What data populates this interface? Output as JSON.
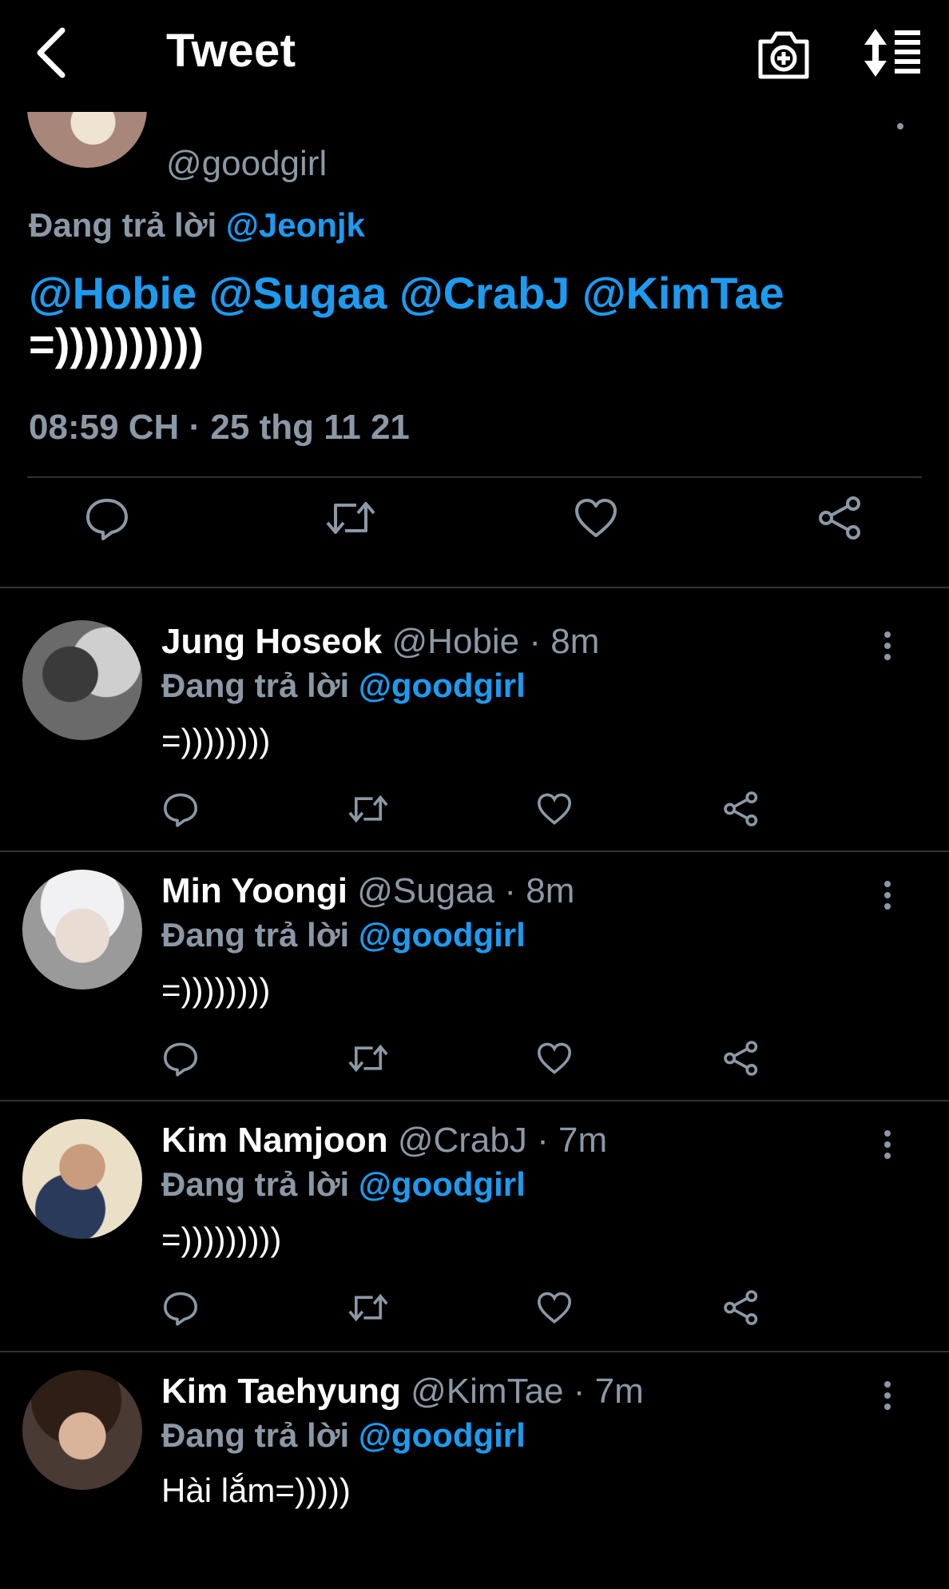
{
  "header": {
    "title": "Tweet",
    "back_icon": "chevron-left-icon",
    "camera_icon": "camera-add-icon",
    "sort_icon": "sort-list-icon"
  },
  "main_tweet": {
    "handle": "@goodgirl",
    "replying_prefix": "Đang trả lời",
    "replying_to": "@Jeonjk",
    "mentions": [
      "@Hobie",
      "@Sugaa",
      "@CrabJ",
      "@KimTae"
    ],
    "text": "=))))))))))",
    "timestamp": "08:59 CH · 25 thg 11 21"
  },
  "replies": [
    {
      "name": "Jung Hoseok",
      "handle": "@Hobie",
      "time": "8m",
      "replying_prefix": "Đang trả lời",
      "replying_to": "@goodgirl",
      "text": "=))))))))"
    },
    {
      "name": "Min Yoongi",
      "handle": "@Sugaa",
      "time": "8m",
      "replying_prefix": "Đang trả lời",
      "replying_to": "@goodgirl",
      "text": "=))))))))"
    },
    {
      "name": "Kim Namjoon",
      "handle": "@CrabJ",
      "time": "7m",
      "replying_prefix": "Đang trả lời",
      "replying_to": "@goodgirl",
      "text": "=)))))))))"
    },
    {
      "name": "Kim Taehyung",
      "handle": "@KimTae",
      "time": "7m",
      "replying_prefix": "Đang trả lời",
      "replying_to": "@goodgirl",
      "text": "Hài lắm=)))))"
    }
  ],
  "colors": {
    "background": "#000000",
    "accent": "#1d9bf0",
    "secondary_text": "#8b98a5",
    "divider": "#2f3336"
  }
}
